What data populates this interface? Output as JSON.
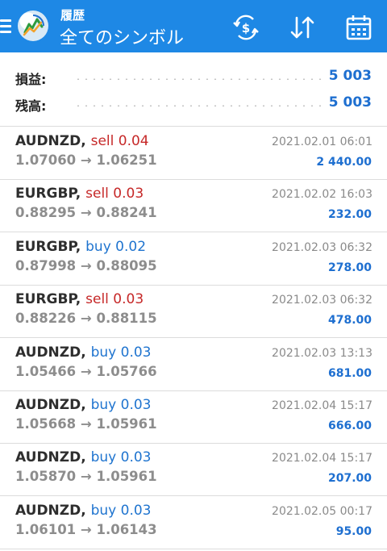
{
  "appbar": {
    "title_small": "履歴",
    "title_big": "全てのシンボル"
  },
  "colors": {
    "appbar": "#1e88e5",
    "sell": "#c62828",
    "buy": "#1f74cf",
    "profit": "#1e6fd0"
  },
  "icons": [
    "menu-icon",
    "app-logo-icon",
    "currency-exchange-icon",
    "sort-icon",
    "calendar-icon"
  ],
  "summary": {
    "profit_label": "損益:",
    "profit_value": "5 003",
    "balance_label": "残高:",
    "balance_value": "5 003"
  },
  "trades": [
    {
      "symbol": "AUDNZD,",
      "side": "sell",
      "side_text": "sell 0.04",
      "prices": "1.07060 → 1.06251",
      "datetime": "2021.02.01 06:01",
      "profit": "2 440.00"
    },
    {
      "symbol": "EURGBP,",
      "side": "sell",
      "side_text": "sell 0.03",
      "prices": "0.88295 → 0.88241",
      "datetime": "2021.02.02 16:03",
      "profit": "232.00"
    },
    {
      "symbol": "EURGBP,",
      "side": "buy",
      "side_text": "buy 0.02",
      "prices": "0.87998 → 0.88095",
      "datetime": "2021.02.03 06:32",
      "profit": "278.00"
    },
    {
      "symbol": "EURGBP,",
      "side": "sell",
      "side_text": "sell 0.03",
      "prices": "0.88226 → 0.88115",
      "datetime": "2021.02.03 06:32",
      "profit": "478.00"
    },
    {
      "symbol": "AUDNZD,",
      "side": "buy",
      "side_text": "buy 0.03",
      "prices": "1.05466 → 1.05766",
      "datetime": "2021.02.03 13:13",
      "profit": "681.00"
    },
    {
      "symbol": "AUDNZD,",
      "side": "buy",
      "side_text": "buy 0.03",
      "prices": "1.05668 → 1.05961",
      "datetime": "2021.02.04 15:17",
      "profit": "666.00"
    },
    {
      "symbol": "AUDNZD,",
      "side": "buy",
      "side_text": "buy 0.03",
      "prices": "1.05870 → 1.05961",
      "datetime": "2021.02.04 15:17",
      "profit": "207.00"
    },
    {
      "symbol": "AUDNZD,",
      "side": "buy",
      "side_text": "buy 0.03",
      "prices": "1.06101 → 1.06143",
      "datetime": "2021.02.05 00:17",
      "profit": "95.00"
    }
  ]
}
